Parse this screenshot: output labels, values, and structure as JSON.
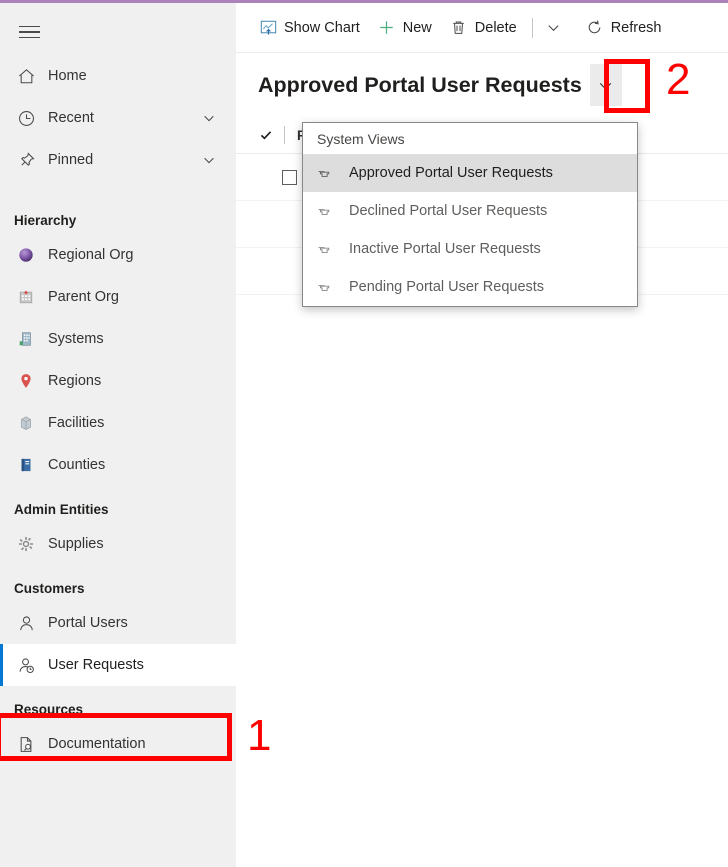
{
  "theme": {
    "accent_bar_color": "#ad82bb",
    "sidebar_bg": "#f0f0f0",
    "selected_indicator_color": "#0078d4",
    "annotation_color": "#ff0000",
    "flyout_active_bg": "#dddddd"
  },
  "sidenav": {
    "menu_button": {
      "icon": "hamburger-icon"
    },
    "top_items": [
      {
        "label": "Home",
        "icon": "home-icon",
        "expandable": false
      },
      {
        "label": "Recent",
        "icon": "clock-icon",
        "expandable": true
      },
      {
        "label": "Pinned",
        "icon": "pin-icon",
        "expandable": true
      }
    ],
    "groups": [
      {
        "title": "Hierarchy",
        "items": [
          {
            "label": "Regional Org",
            "icon": "sphere-icon"
          },
          {
            "label": "Parent Org",
            "icon": "hospital-icon"
          },
          {
            "label": "Systems",
            "icon": "office-building-icon"
          },
          {
            "label": "Regions",
            "icon": "map-pin-icon"
          },
          {
            "label": "Facilities",
            "icon": "facility-icon"
          },
          {
            "label": "Counties",
            "icon": "book-icon"
          }
        ]
      },
      {
        "title": "Admin Entities",
        "items": [
          {
            "label": "Supplies",
            "icon": "gear-icon"
          }
        ]
      },
      {
        "title": "Customers",
        "items": [
          {
            "label": "Portal Users",
            "icon": "person-icon"
          },
          {
            "label": "User Requests",
            "icon": "person-clock-icon",
            "selected": true
          }
        ]
      },
      {
        "title": "Resources",
        "items": [
          {
            "label": "Documentation",
            "icon": "document-search-icon"
          }
        ]
      }
    ]
  },
  "command_bar": {
    "commands": [
      {
        "label": "Show Chart",
        "icon": "chart-icon"
      },
      {
        "label": "New",
        "icon": "plus-icon"
      },
      {
        "label": "Delete",
        "icon": "trash-icon"
      }
    ],
    "overflow": {
      "icon": "chevron-down-icon"
    },
    "refresh": {
      "label": "Refresh",
      "icon": "refresh-icon"
    }
  },
  "view_header": {
    "title": "Approved Portal User Requests",
    "selector": {
      "icon": "chevron-down-icon"
    }
  },
  "grid": {
    "select_all": {
      "icon": "checkmark-icon"
    },
    "first_column_header": "F",
    "row_checkbox": {
      "checked": false
    }
  },
  "view_flyout": {
    "header": "System Views",
    "items": [
      {
        "label": "Approved Portal User Requests",
        "icon": "pin-icon",
        "selected": true
      },
      {
        "label": "Declined Portal User Requests",
        "icon": "pin-icon",
        "selected": false
      },
      {
        "label": "Inactive Portal User Requests",
        "icon": "pin-icon",
        "selected": false
      },
      {
        "label": "Pending Portal User Requests",
        "icon": "pin-icon",
        "selected": false
      }
    ]
  },
  "annotations": [
    {
      "number": "1",
      "target": "sidebar-item-user-requests"
    },
    {
      "number": "2",
      "target": "view-selector-button"
    }
  ]
}
